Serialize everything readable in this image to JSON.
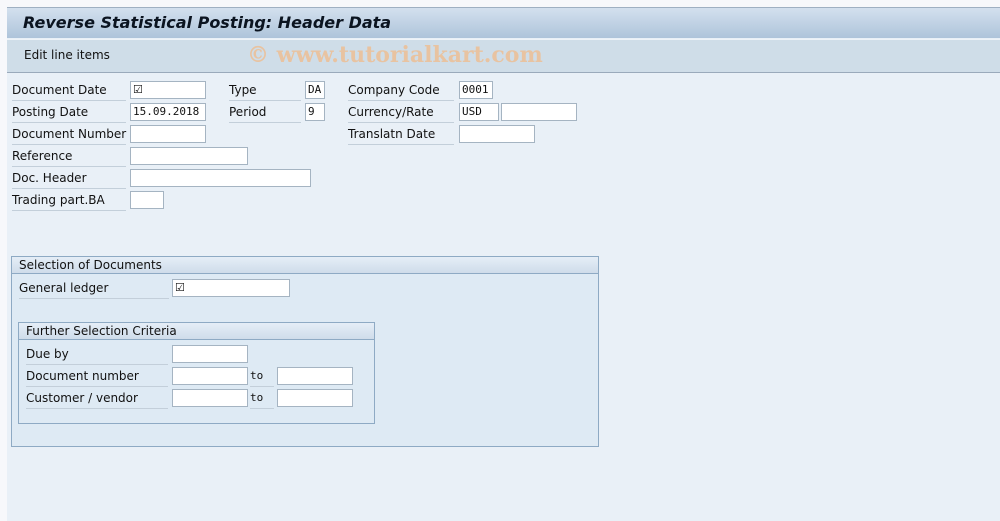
{
  "header": {
    "title": "Reverse Statistical Posting: Header Data"
  },
  "toolbar": {
    "edit_line_items": "Edit line items"
  },
  "watermark": "© www.tutorialkart.com",
  "header_data": {
    "document_date": {
      "label": "Document Date",
      "value": "☑",
      "value_icon": "checkbox-checked"
    },
    "posting_date": {
      "label": "Posting Date",
      "value": "15.09.2018"
    },
    "document_number": {
      "label": "Document Number",
      "value": ""
    },
    "reference": {
      "label": "Reference",
      "value": ""
    },
    "doc_header": {
      "label": "Doc. Header",
      "value": ""
    },
    "trading_part_ba": {
      "label": "Trading part.BA",
      "value": ""
    },
    "type": {
      "label": "Type",
      "value": "DA"
    },
    "period": {
      "label": "Period",
      "value": "9"
    },
    "company_code": {
      "label": "Company Code",
      "value": "0001"
    },
    "currency_rate": {
      "label": "Currency/Rate",
      "currency": "USD",
      "rate": ""
    },
    "translatn_date": {
      "label": "Translatn Date",
      "value": ""
    }
  },
  "selection": {
    "title": "Selection of Documents",
    "general_ledger": {
      "label": "General ledger",
      "value": "☑",
      "value_icon": "checkbox-checked"
    },
    "further": {
      "title": "Further Selection Criteria",
      "due_by": {
        "label": "Due by",
        "value": ""
      },
      "document_number": {
        "label": "Document number",
        "from": "",
        "to_label": "to",
        "to": ""
      },
      "customer_vendor": {
        "label": "Customer / vendor",
        "from": "",
        "to_label": "to",
        "to": ""
      }
    }
  }
}
